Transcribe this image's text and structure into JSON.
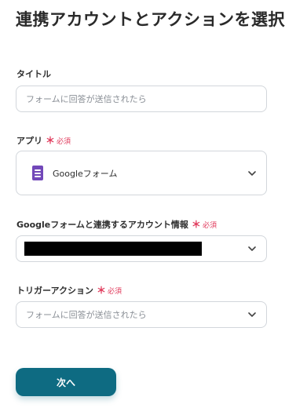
{
  "page": {
    "title": "連携アカウントとアクションを選択"
  },
  "title_field": {
    "label": "タイトル",
    "value": "フォームに回答が送信されたら"
  },
  "app_field": {
    "label": "アプリ",
    "required_mark": "＊",
    "required_text": "必須",
    "value": "Googleフォーム",
    "icon": "google-forms-icon",
    "icon_color": "#7248b9"
  },
  "account_field": {
    "label": "Googleフォームと連携するアカウント情報",
    "required_mark": "＊",
    "required_text": "必須"
  },
  "trigger_field": {
    "label": "トリガーアクション",
    "required_mark": "＊",
    "required_text": "必須",
    "value": "フォームに回答が送信されたら"
  },
  "actions": {
    "next_label": "次へ"
  },
  "colors": {
    "accent": "#0e6b82",
    "required": "#e0385a",
    "border": "#d2d6db"
  }
}
